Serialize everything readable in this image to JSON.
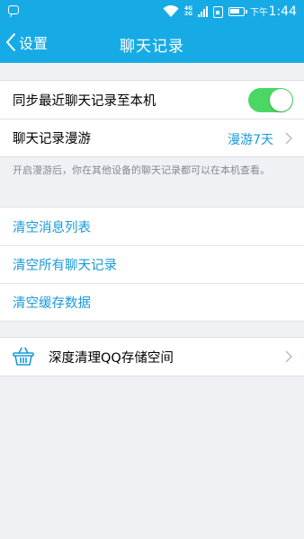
{
  "status_bar": {
    "network": [
      "4G",
      "2G"
    ],
    "time_period": "下午",
    "time": "1:44"
  },
  "nav": {
    "back_label": "设置",
    "title": "聊天记录"
  },
  "sync": {
    "label": "同步最近聊天记录至本机",
    "toggle_on": true
  },
  "roaming": {
    "label": "聊天记录漫游",
    "value": "漫游7天",
    "description": "开启漫游后，你在其他设备的聊天记录都可以在本机查看。"
  },
  "actions": [
    "清空消息列表",
    "清空所有聊天记录",
    "清空缓存数据"
  ],
  "deep_clean": {
    "label": "深度清理QQ存储空间",
    "icon": "basket-icon"
  },
  "colors": {
    "header": "#17abe6",
    "accent": "#1a9ad8",
    "toggle": "#4bd763",
    "background": "#eff1f4"
  }
}
